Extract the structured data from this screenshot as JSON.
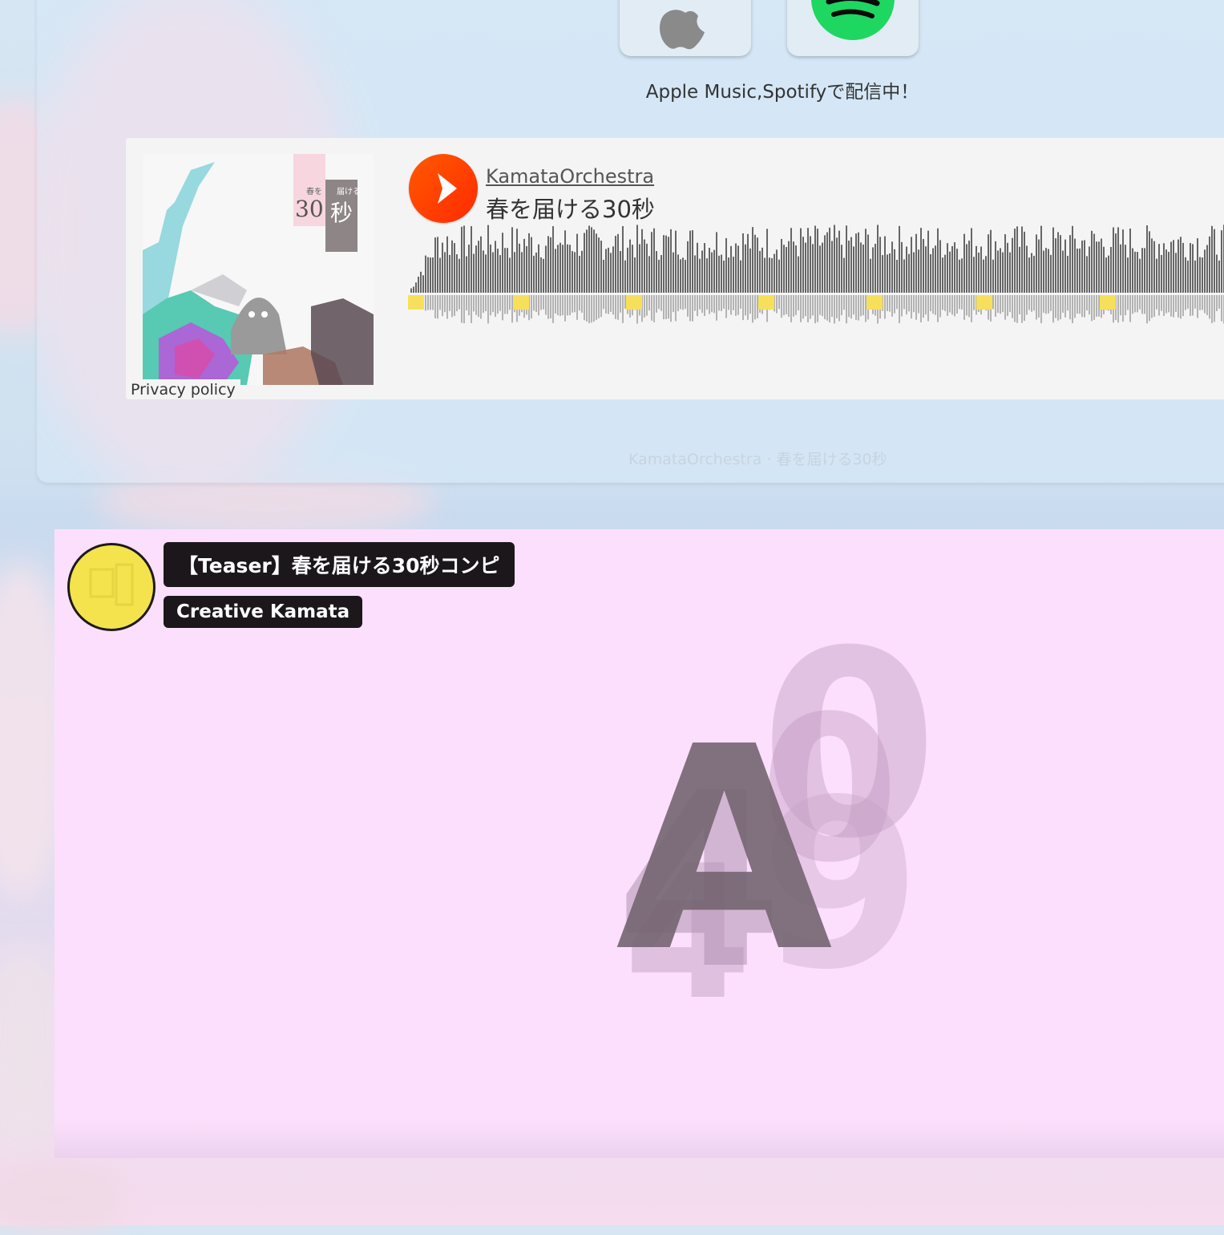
{
  "streaming": {
    "caption": "Apple Music,Spotifyで配信中！",
    "apple_icon": "apple-icon",
    "spotify_icon": "spotify-icon",
    "spotify_color": "#1ed760"
  },
  "player": {
    "artist": "KamataOrchestra",
    "track": "春を届ける30秒",
    "privacy": "Privacy policy",
    "accent": "#ff3c00",
    "artwork": {
      "line1": "春を",
      "line2": "届ける",
      "num": "30",
      "kanji": "秒"
    }
  },
  "footer_credit": "KamataOrchestra · 春を届ける30秒",
  "video": {
    "title": "【Teaser】春を届ける30秒コンピ",
    "channel": "Creative Kamata",
    "glyphs": [
      "A",
      "0",
      "0",
      "4",
      "4",
      "9"
    ]
  }
}
